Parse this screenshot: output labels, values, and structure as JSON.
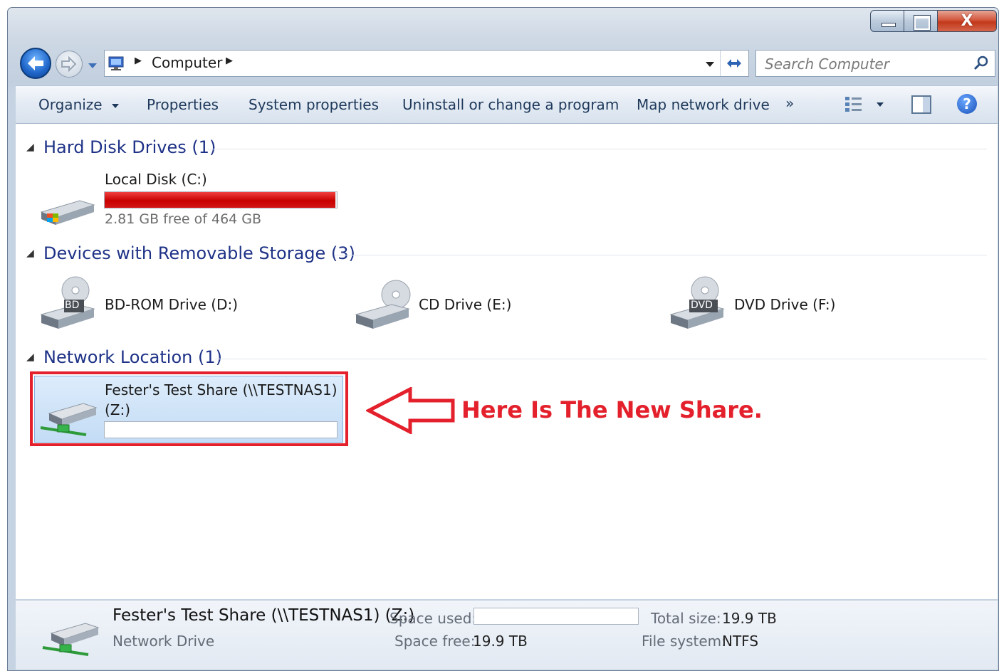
{
  "window": {
    "caption_buttons": {
      "minimize": "minimize",
      "maximize": "maximize",
      "close": "X"
    }
  },
  "address_bar": {
    "breadcrumb": [
      "Computer"
    ],
    "search_placeholder": "Search Computer"
  },
  "toolbar": {
    "organize": "Organize",
    "properties": "Properties",
    "system_properties": "System properties",
    "uninstall": "Uninstall or change a program",
    "map_network_drive": "Map network drive",
    "more": "»"
  },
  "groups": {
    "hard_disk": {
      "title": "Hard Disk Drives (1)",
      "items": [
        {
          "name": "Local Disk (C:)",
          "free_text": "2.81 GB free of 464 GB",
          "used_fraction": 0.994
        }
      ]
    },
    "removable": {
      "title": "Devices with Removable Storage (3)",
      "items": [
        {
          "name": "BD-ROM Drive (D:)",
          "badge": "BD"
        },
        {
          "name": "CD Drive (E:)",
          "badge": ""
        },
        {
          "name": "DVD Drive (F:)",
          "badge": "DVD"
        }
      ]
    },
    "network": {
      "title": "Network Location (1)",
      "items": [
        {
          "name_line1": "Fester's Test Share (\\\\TESTNAS1)",
          "name_line2": "(Z:)",
          "used_fraction": 0
        }
      ]
    }
  },
  "annotation": {
    "text": "Here Is The New Share.",
    "color": "#e3202b"
  },
  "details": {
    "title": "Fester's Test Share (\\\\TESTNAS1) (Z:)",
    "type": "Network Drive",
    "space_used_label": "Space used:",
    "space_free_label": "Space free:",
    "space_free_value": "19.9 TB",
    "total_size_label": "Total size:",
    "total_size_value": "19.9 TB",
    "file_system_label": "File system:",
    "file_system_value": "NTFS"
  },
  "colors": {
    "accent_blue": "#1e3287",
    "selection": "#cce4f7",
    "disk_full_red": "#d10a0a"
  }
}
